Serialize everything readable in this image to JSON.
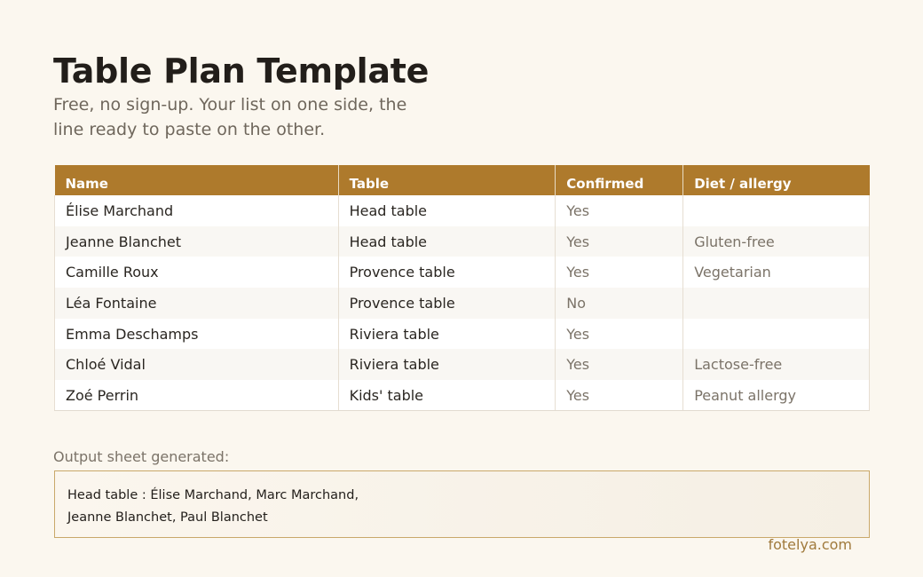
{
  "header": {
    "title": "Table Plan Template",
    "subtitle": "Free, no sign-up. Your list on one side, the line ready to paste on the other."
  },
  "sheet": {
    "columns": [
      "Name",
      "Table",
      "Confirmed",
      "Diet / allergy"
    ],
    "rows": [
      {
        "name": "Élise Marchand",
        "table": "Head table",
        "confirmed": "Yes",
        "diet": ""
      },
      {
        "name": "Jeanne Blanchet",
        "table": "Head table",
        "confirmed": "Yes",
        "diet": "Gluten-free"
      },
      {
        "name": "Camille Roux",
        "table": "Provence table",
        "confirmed": "Yes",
        "diet": "Vegetarian"
      },
      {
        "name": "Léa Fontaine",
        "table": "Provence table",
        "confirmed": "No",
        "diet": ""
      },
      {
        "name": "Emma Deschamps",
        "table": "Riviera table",
        "confirmed": "Yes",
        "diet": ""
      },
      {
        "name": "Chloé Vidal",
        "table": "Riviera table",
        "confirmed": "Yes",
        "diet": "Lactose-free"
      },
      {
        "name": "Zoé Perrin",
        "table": "Kids' table",
        "confirmed": "Yes",
        "diet": "Peanut allergy"
      }
    ],
    "colors": {
      "header_bg": "#ae7a2c",
      "header_text": "#ffffff"
    }
  },
  "output": {
    "label": "Output sheet generated:",
    "lines": [
      "Head table : Élise Marchand, Marc Marchand,",
      "Jeanne Blanchet, Paul Blanchet"
    ]
  },
  "footer": {
    "brand": "fotelya.com"
  }
}
